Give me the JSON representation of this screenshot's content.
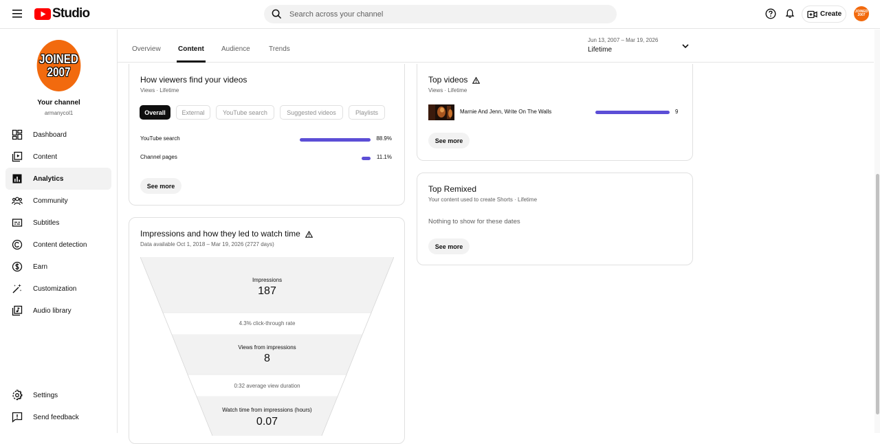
{
  "header": {
    "logo_text": "Studio",
    "search_placeholder": "Search across your channel",
    "create_label": "Create",
    "avatar_text_1": "JOINED",
    "avatar_text_2": "2007"
  },
  "sidebar": {
    "channel_avatar_line1": "JOINED",
    "channel_avatar_line2": "2007",
    "channel_title": "Your channel",
    "channel_handle": "armanycol1",
    "items": [
      {
        "label": "Dashboard",
        "icon": "dashboard-icon"
      },
      {
        "label": "Content",
        "icon": "content-icon"
      },
      {
        "label": "Analytics",
        "icon": "analytics-icon",
        "active": true
      },
      {
        "label": "Community",
        "icon": "community-icon"
      },
      {
        "label": "Subtitles",
        "icon": "subtitles-icon"
      },
      {
        "label": "Content detection",
        "icon": "copyright-icon"
      },
      {
        "label": "Earn",
        "icon": "dollar-icon"
      },
      {
        "label": "Customization",
        "icon": "magic-wand-icon"
      },
      {
        "label": "Audio library",
        "icon": "audio-library-icon"
      }
    ],
    "bottom_items": [
      {
        "label": "Settings",
        "icon": "gear-icon"
      },
      {
        "label": "Send feedback",
        "icon": "feedback-icon"
      }
    ]
  },
  "tabs": {
    "items": [
      "Overview",
      "Content",
      "Audience",
      "Trends"
    ],
    "active": "Content",
    "date_range": "Jun 13, 2007 – Mar 19, 2026",
    "period": "Lifetime"
  },
  "traffic_card": {
    "title": "How viewers find your videos",
    "subtitle": "Views · Lifetime",
    "chips": [
      "Overall",
      "External",
      "YouTube search",
      "Suggested videos",
      "Playlists"
    ],
    "active_chip": "Overall",
    "rows": [
      {
        "label": "YouTube search",
        "value": "88.9%",
        "fraction": 0.889
      },
      {
        "label": "Channel pages",
        "value": "11.1%",
        "fraction": 0.111
      }
    ],
    "see_more": "See more"
  },
  "impressions_card": {
    "title": "Impressions and how they led to watch time",
    "subtitle": "Data available Oct 1, 2018 – Mar 19, 2026 (2727 days)",
    "impressions_label": "Impressions",
    "impressions_value": "187",
    "ctr_text": "4.3% click-through rate",
    "views_label": "Views from impressions",
    "views_value": "8",
    "avd_text": "0:32 average view duration",
    "watch_label": "Watch time from impressions (hours)",
    "watch_value": "0.07"
  },
  "top_videos_card": {
    "title": "Top videos",
    "subtitle": "Views · Lifetime",
    "videos": [
      {
        "title": "Marnie And Jenn, Write On The Walls",
        "views": "9",
        "fraction": 1.0
      }
    ],
    "see_more": "See more"
  },
  "top_remixed_card": {
    "title": "Top Remixed",
    "subtitle": "Your content used to create Shorts · Lifetime",
    "empty_text": "Nothing to show for these dates",
    "see_more": "See more"
  },
  "colors": {
    "accent_bar": "#5c4ed6",
    "brand_red": "#ff0000",
    "avatar_orange": "#f26a0e"
  }
}
